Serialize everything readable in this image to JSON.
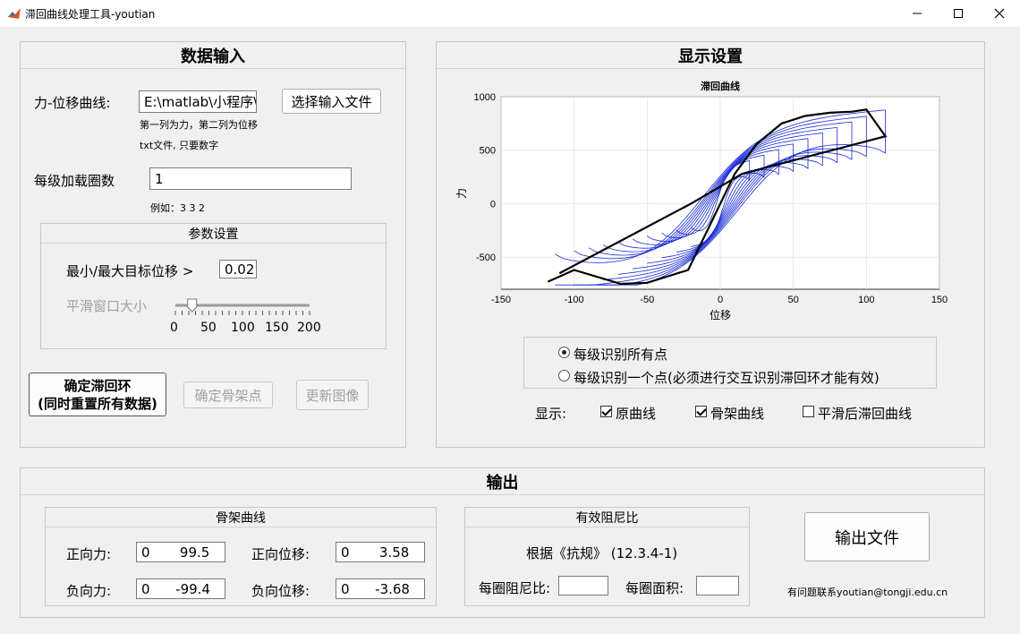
{
  "window": {
    "title": "滞回曲线处理工具-youtian"
  },
  "input_panel": {
    "title": "数据输入",
    "force_disp_label": "力-位移曲线:",
    "file_path_value": "E:\\matlab\\小程序\\",
    "select_file_button": "选择输入文件",
    "hint_line1": "第一列为力，第二列为位移",
    "hint_line2": "txt文件, 只要数字",
    "cycles_label": "每级加载圈数",
    "cycles_value": "1",
    "cycles_example": "例如：3 3 2",
    "params": {
      "title": "参数设置",
      "min_max_label": "最小/最大目标位移 >",
      "min_max_value": "0.02",
      "smooth_label": "平滑窗口大小",
      "slider_ticks": [
        "0",
        "50",
        "100",
        "150",
        "200"
      ],
      "slider_value": 25
    },
    "confirm_loop_button_line1": "确定滞回环",
    "confirm_loop_button_line2": "(同时重置所有数据)",
    "confirm_skeleton_button": "确定骨架点",
    "update_image_button": "更新图像"
  },
  "display_panel": {
    "title": "显示设置",
    "radio_all": "每级识别所有点",
    "radio_one": "每级识别一个点(必须进行交互识别滞回环才能有效)",
    "show_label": "显示:",
    "check_original": "原曲线",
    "check_skeleton": "骨架曲线",
    "check_smoothed": "平滑后滞回曲线"
  },
  "chart_data": {
    "type": "line",
    "title": "滞回曲线",
    "xlabel": "位移",
    "ylabel": "力",
    "xlim": [
      -150,
      150
    ],
    "ylim": [
      -800,
      1000
    ],
    "xticks": [
      "-150",
      "-100",
      "-50",
      "0",
      "50",
      "100",
      "150"
    ],
    "yticks": [
      "1000",
      "500",
      "0",
      "-500"
    ],
    "grid": true,
    "colors": {
      "hysteresis": "#1a2bd8",
      "skeleton": "#000000"
    },
    "hysteresis_amplitudes": [
      20,
      30,
      40,
      50,
      60,
      70,
      80,
      90,
      100,
      113
    ],
    "skeleton": {
      "x": [
        -118,
        -100,
        -68,
        -50,
        -22,
        10,
        25,
        42,
        58,
        75,
        90,
        100,
        113,
        15,
        -20,
        -110
      ],
      "y": [
        -730,
        -620,
        -750,
        -740,
        -620,
        280,
        560,
        750,
        820,
        850,
        860,
        880,
        630,
        280,
        0,
        -650
      ]
    }
  },
  "output_panel": {
    "title": "输出",
    "skeleton": {
      "title": "骨架曲线",
      "pos_force_label": "正向力:",
      "pos_force_value": "0       99.5",
      "pos_disp_label": "正向位移:",
      "pos_disp_value": "0       3.58",
      "neg_force_label": "负向力:",
      "neg_force_value": "0      -99.4",
      "neg_disp_label": "负向位移:",
      "neg_disp_value": "0      -3.68"
    },
    "damping": {
      "title": "有效阻尼比",
      "basis": "根据《抗规》 (12.3.4-1)",
      "per_cycle_damping_label": "每圈阻尼比:",
      "per_cycle_area_label": "每圈面积:"
    },
    "export_button": "输出文件",
    "contact": "有问题联系youtian@tongji.edu.cn"
  }
}
